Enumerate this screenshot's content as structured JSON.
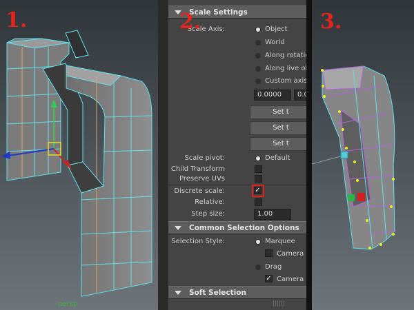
{
  "markers": {
    "one": "1.",
    "two": "2.",
    "three": "3."
  },
  "viewport1": {
    "camera_label": "persp"
  },
  "editor": {
    "scale_settings": {
      "title": "Scale Settings",
      "scale_axis_label": "Scale Axis:",
      "axis_options": [
        "Object",
        "World",
        "Along rotation",
        "Along live obje",
        "Custom axis o"
      ],
      "selected_axis": "Object",
      "custom_value_1": "0.0000",
      "custom_value_2": "0.0",
      "set_buttons": [
        "Set t",
        "Set t",
        "Set t"
      ],
      "scale_pivot_label": "Scale pivot:",
      "scale_pivot_value": "Default",
      "preserve_child_label": "Preserve Child Transform",
      "preserve_uvs_label": "Preserve UVs",
      "discrete_scale_label": "Discrete scale:",
      "discrete_scale_checked": true,
      "relative_label": "Relative:",
      "step_size_label": "Step size:",
      "step_size_value": "1.00"
    },
    "common_selection": {
      "title": "Common Selection Options",
      "selection_style_label": "Selection Style:",
      "marquee": "Marquee",
      "camera_based_1": "Camera ba",
      "drag": "Drag",
      "camera_based_2": "Camera ba",
      "camera_based_2_checked": true
    },
    "soft_selection": {
      "title": "Soft Selection"
    }
  },
  "colors": {
    "marker_red": "#e3251d",
    "wire_cyan": "#62e1ee",
    "wire_purple": "#b860e0",
    "vertex_yellow": "#e8f02a"
  }
}
